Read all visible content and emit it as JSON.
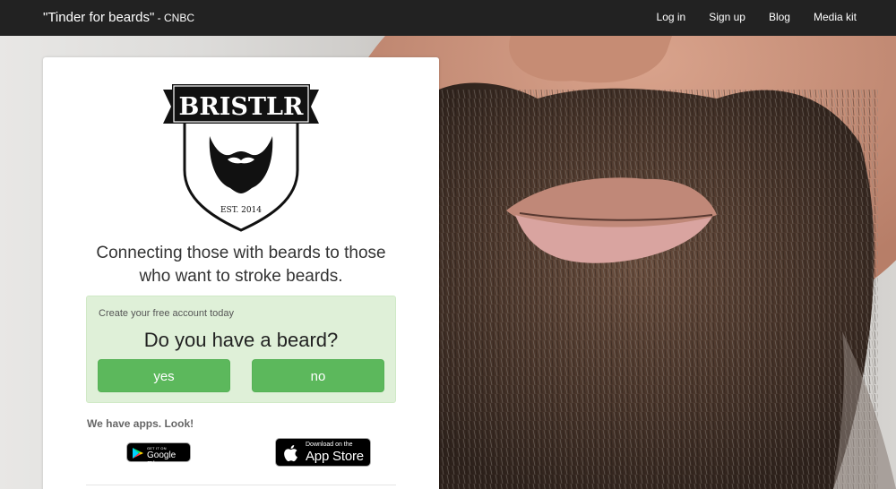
{
  "navbar": {
    "quote": "\"Tinder for beards\"",
    "source": " - CNBC",
    "links": [
      "Log in",
      "Sign up",
      "Blog",
      "Media kit"
    ]
  },
  "logo": {
    "name": "BRISTLR",
    "est": "EST. 2014"
  },
  "tagline": {
    "line1": "Connecting those with beards to those",
    "line2": "who want to stroke beards."
  },
  "signup": {
    "subtitle": "Create your free account today",
    "question": "Do you have a beard?",
    "yes_label": "yes",
    "no_label": "no"
  },
  "apps": {
    "label": "We have apps. Look!",
    "google_small": "GET IT ON",
    "google_big": "Google Play",
    "apple_small": "Download on the",
    "apple_big": "App Store"
  },
  "colors": {
    "navbar": "#222222",
    "button": "#5cb85c",
    "signup_bg": "#dff0d8"
  }
}
